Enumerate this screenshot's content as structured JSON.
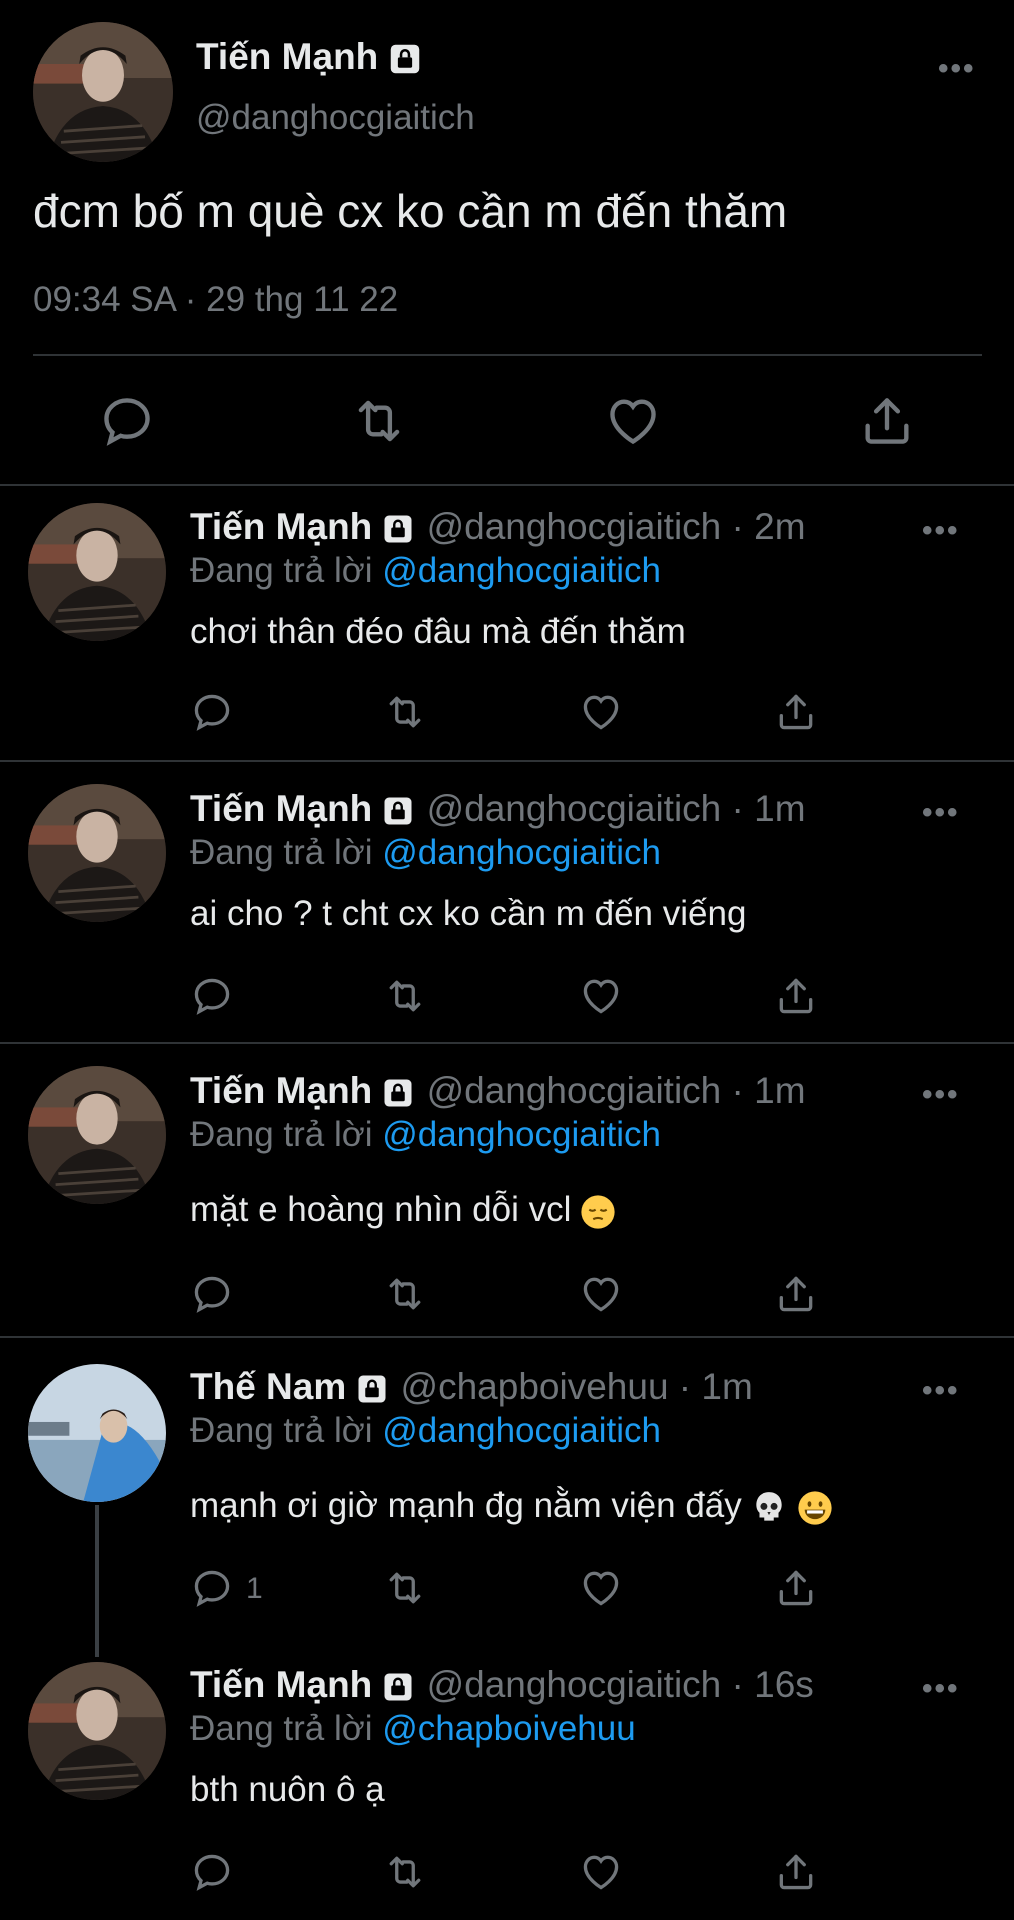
{
  "main_tweet": {
    "name": "Tiến Mạnh",
    "handle": "@danghocgiaitich",
    "text": "đcm bố m què cx ko cần m đến thăm",
    "timestamp": "09:34 SA · 29 thg 11 22",
    "icons": [
      "lock-icon",
      "more-icon",
      "reply-icon",
      "retweet-icon",
      "like-icon",
      "share-icon"
    ]
  },
  "replies": [
    {
      "name": "Tiến Mạnh",
      "meta": "@danghocgiaitich · 2m",
      "replying_prefix": "Đang trả lời ",
      "replying_to": "@danghocgiaitich",
      "text": "chơi thân đéo đâu mà đến thăm",
      "reply_count": ""
    },
    {
      "name": "Tiến Mạnh",
      "meta": "@danghocgiaitich · 1m",
      "replying_prefix": "Đang trả lời ",
      "replying_to": "@danghocgiaitich",
      "text": "ai cho ? t cht cx ko cần m đến viếng",
      "reply_count": ""
    },
    {
      "name": "Tiến Mạnh",
      "meta": "@danghocgiaitich · 1m",
      "replying_prefix": "Đang trả lời ",
      "replying_to": "@danghocgiaitich",
      "text": "mặt e hoàng nhìn dỗi vcl",
      "emoji": [
        "pensive-face-emoji"
      ],
      "reply_count": ""
    },
    {
      "name": "Thế Nam",
      "meta": "@chapboivehuu · 1m",
      "replying_prefix": "Đang trả lời ",
      "replying_to": "@danghocgiaitich",
      "text": "mạnh ơi giờ mạnh đg nằm viện đấy",
      "emoji": [
        "skull-emoji",
        "grinning-face-emoji"
      ],
      "reply_count": "1"
    },
    {
      "name": "Tiến Mạnh",
      "meta": "@danghocgiaitich · 16s",
      "replying_prefix": "Đang trả lời ",
      "replying_to": "@chapboivehuu",
      "text": "bth nuôn ô ạ",
      "reply_count": ""
    }
  ],
  "colors": {
    "background": "#000000",
    "text_primary": "#e7e9ea",
    "text_secondary": "#71767b",
    "mention": "#1d9bf0",
    "divider": "#2f3336"
  }
}
